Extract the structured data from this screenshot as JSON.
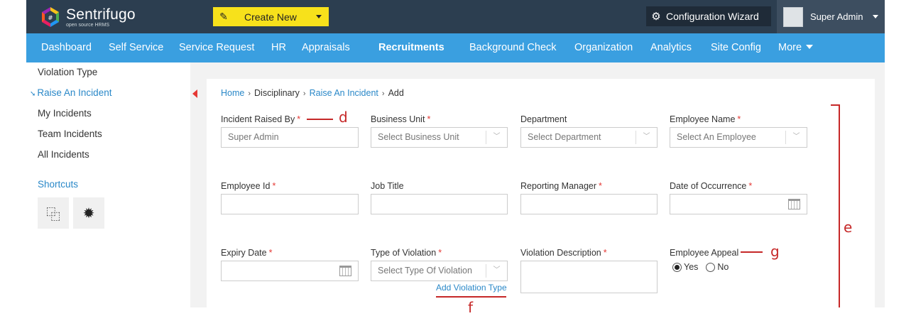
{
  "header": {
    "logo_name": "Sentrifugo",
    "logo_sub": "open source HRMS",
    "create_label": "Create New",
    "config_label": "Configuration Wizard",
    "user_name": "Super Admin"
  },
  "nav": {
    "items": [
      "Dashboard",
      "Self Service",
      "Service Request",
      "HR",
      "Appraisals",
      "Recruitments",
      "Background Check",
      "Organization",
      "Analytics",
      "Site Config",
      "More"
    ],
    "active": "Recruitments"
  },
  "sidebar": {
    "items": [
      "Violation Type",
      "Raise An Incident",
      "My Incidents",
      "Team Incidents",
      "All Incidents"
    ],
    "active": "Raise An Incident",
    "shortcuts_title": "Shortcuts"
  },
  "breadcrumb": [
    "Home",
    "Disciplinary",
    "Raise An Incident",
    "Add"
  ],
  "form": {
    "incident_raised_by": {
      "label": "Incident Raised By",
      "value": "Super Admin"
    },
    "business_unit": {
      "label": "Business Unit",
      "placeholder": "Select Business Unit"
    },
    "department": {
      "label": "Department",
      "placeholder": "Select Department"
    },
    "employee_name": {
      "label": "Employee Name",
      "placeholder": "Select An Employee"
    },
    "employee_id": {
      "label": "Employee Id"
    },
    "job_title": {
      "label": "Job Title"
    },
    "reporting_manager": {
      "label": "Reporting Manager"
    },
    "date_of_occurrence": {
      "label": "Date of Occurrence"
    },
    "expiry_date": {
      "label": "Expiry Date"
    },
    "type_of_violation": {
      "label": "Type of Violation",
      "placeholder": "Select Type Of Violation"
    },
    "violation_description": {
      "label": "Violation Description"
    },
    "employee_appeal": {
      "label": "Employee Appeal",
      "yes": "Yes",
      "no": "No",
      "selected": "Yes"
    },
    "add_violation_type": "Add Violation Type"
  },
  "annotations": {
    "d": "d",
    "e": "e",
    "f": "f",
    "g": "g"
  },
  "colors": {
    "topbar": "#2c3e50",
    "navbar": "#3a9fe0",
    "create_button": "#f7e11b",
    "link": "#2a88c8",
    "required": "#e53935",
    "annotation": "#c62828"
  }
}
